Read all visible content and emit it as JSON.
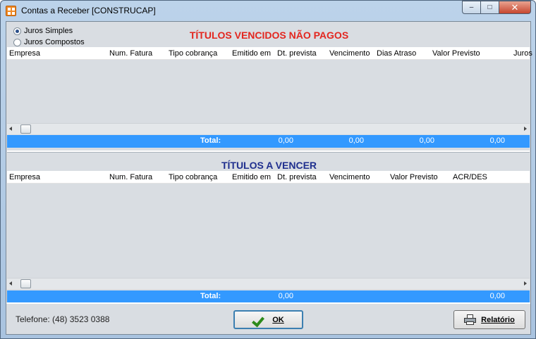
{
  "window": {
    "title": "Contas a Receber [CONSTRUCAP]",
    "icon": "app-icon",
    "controls": {
      "minimize": "–",
      "maximize": "□",
      "close": "✕"
    }
  },
  "interest_options": [
    {
      "label": "Juros Simples",
      "checked": true
    },
    {
      "label": "Juros Compostos",
      "checked": false
    }
  ],
  "overdue": {
    "title": "TÍTULOS VENCIDOS NÃO PAGOS",
    "title_color": "#e3261f",
    "columns": [
      "Empresa",
      "Num. Fatura",
      "Tipo cobrança",
      "Emitido em",
      "Dt. prevista",
      "Vencimento",
      "Dias Atraso",
      "Valor Previsto",
      "Juros"
    ],
    "rows": [],
    "total": {
      "label": "Total:",
      "values": [
        "0,00",
        "0,00",
        "0,00",
        "0,00"
      ]
    }
  },
  "upcoming": {
    "title": "TÍTULOS A VENCER",
    "title_color": "#1f2f8e",
    "columns": [
      "Empresa",
      "Num. Fatura",
      "Tipo cobrança",
      "Emitido em",
      "Dt. prevista",
      "Vencimento",
      "Valor Previsto",
      "ACR/DES"
    ],
    "rows": [],
    "total": {
      "label": "Total:",
      "values": [
        "0,00",
        "0,00"
      ]
    }
  },
  "footer": {
    "phone_label": "Telefone:",
    "phone": "(48) 3523 0388",
    "ok_label": "OK",
    "report_label": "Relatório"
  },
  "colors": {
    "total_bar": "#3399ff",
    "panel_bg": "#d9dde2"
  }
}
